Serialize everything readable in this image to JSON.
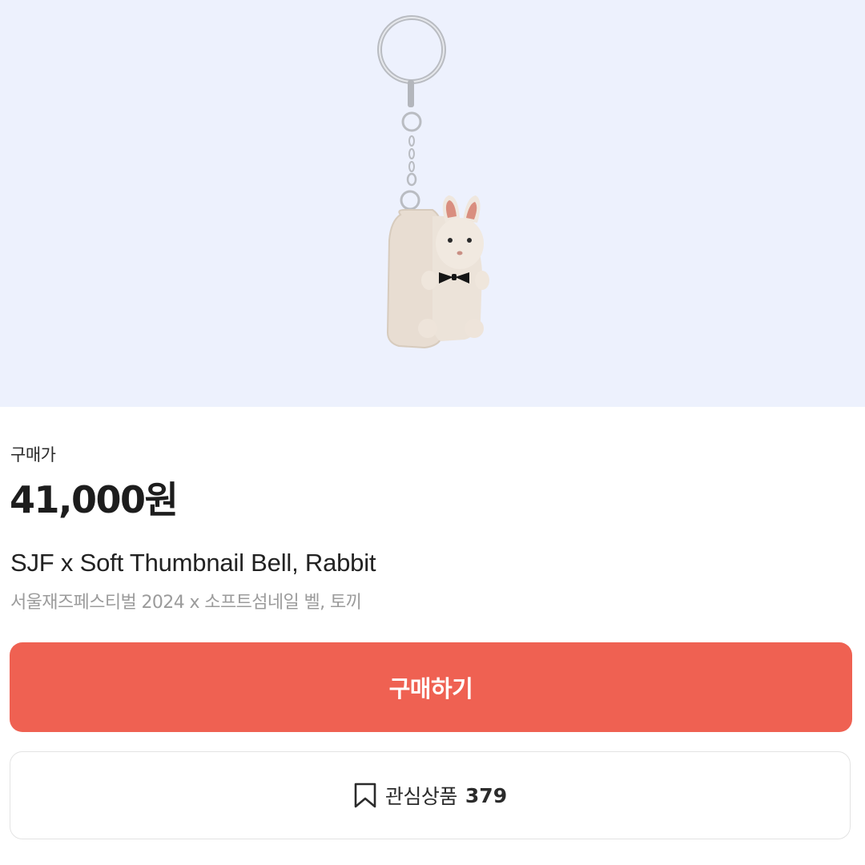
{
  "product": {
    "image_alt": "rabbit-keyring-photo",
    "price_label": "구매가",
    "price": "41,000원",
    "title": "SJF x Soft Thumbnail Bell, Rabbit",
    "subtitle": "서울재즈페스티벌 2024 x 소프트섬네일 벨, 토끼"
  },
  "actions": {
    "buy_label": "구매하기",
    "wishlist_label": "관심상품",
    "wishlist_count": "379"
  },
  "colors": {
    "image_background": "#edf1fd",
    "buy_button": "#ef6152",
    "subtitle_text": "#9b9b9b"
  },
  "icons": {
    "wishlist": "bookmark-icon"
  }
}
